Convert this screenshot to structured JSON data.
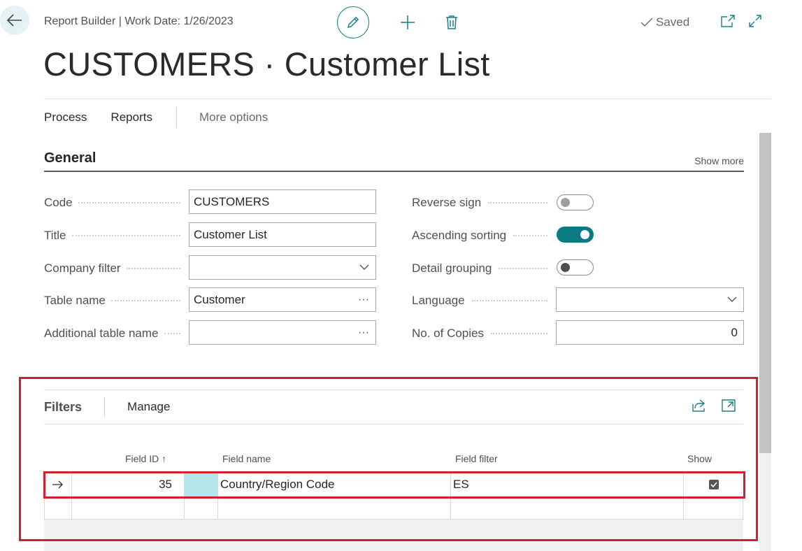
{
  "header": {
    "breadcrumb": "Report Builder | Work Date: 1/26/2023",
    "saved_label": "Saved",
    "page_title": "CUSTOMERS · Customer List"
  },
  "action_bar": {
    "process": "Process",
    "reports": "Reports",
    "more_options": "More options"
  },
  "general": {
    "title": "General",
    "show_more": "Show more",
    "code_label": "Code",
    "code_value": "CUSTOMERS",
    "title_label": "Title",
    "title_value": "Customer List",
    "company_filter_label": "Company filter",
    "company_filter_value": "",
    "table_name_label": "Table name",
    "table_name_value": "Customer",
    "additional_table_label": "Additional table name",
    "additional_table_value": "",
    "reverse_sign_label": "Reverse sign",
    "reverse_sign_on": false,
    "ascending_sorting_label": "Ascending sorting",
    "ascending_sorting_on": true,
    "detail_grouping_label": "Detail grouping",
    "detail_grouping_on": false,
    "language_label": "Language",
    "language_value": "",
    "copies_label": "No. of Copies",
    "copies_value": "0"
  },
  "filters": {
    "title": "Filters",
    "manage": "Manage",
    "columns": {
      "field_id": "Field ID",
      "field_name": "Field name",
      "field_filter": "Field filter",
      "show": "Show"
    },
    "rows": [
      {
        "field_id": "35",
        "field_name": "Country/Region Code",
        "field_filter": "ES",
        "show": true
      }
    ]
  },
  "colors": {
    "accent": "#0a7b83",
    "highlight_border": "#d3202f",
    "selected_cell": "#b3e6ea"
  }
}
